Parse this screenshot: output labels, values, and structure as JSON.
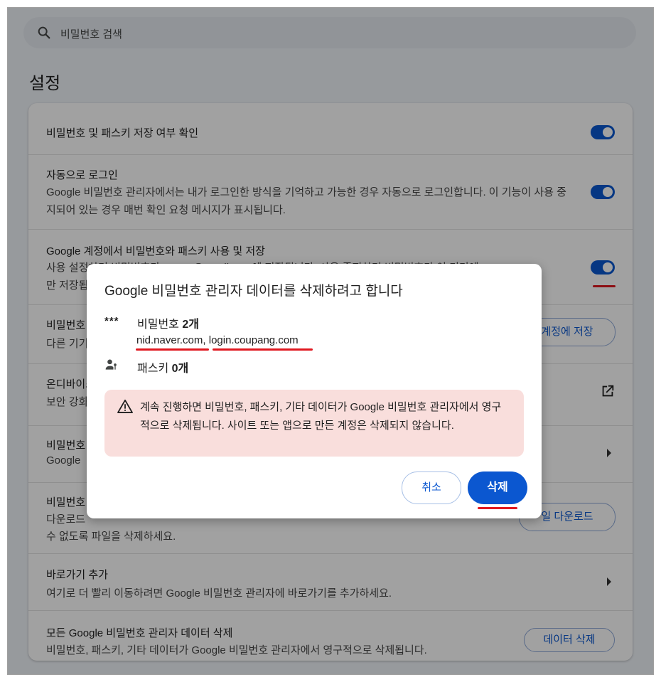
{
  "search": {
    "placeholder": "비밀번호 검색",
    "icon": "search-icon"
  },
  "section_title": "설정",
  "settings": {
    "offer_save": {
      "title": "비밀번호 및 패스키 저장 여부 확인",
      "enabled": true
    },
    "auto_signin": {
      "title": "자동으로 로그인",
      "desc": "Google 비밀번호 관리자에서는 내가 로그인한 방식을 기억하고 가능한 경우 자동으로 로그인합니다. 이 기능이 사용 중지되어 있는 경우 매번 확인 요청 메시지가 표시됩니다.",
      "enabled": true
    },
    "account_storage": {
      "title": "Google 계정에서 비밀번호와 패스키 사용 및 저장",
      "desc_line1": "사용 설정하면 비밀번호가 ..........@gmail.com에 저장됩니다. 사용 중지하면 비밀번호가 이 기기에",
      "desc_line2": "만 저장됩니다.",
      "enabled": true
    },
    "move_passwords": {
      "title": "비밀번호",
      "desc": "다른 기기",
      "button": "계정에 저장"
    },
    "on_device": {
      "title": "온디바이스",
      "desc": "보안 강화",
      "icon": "open-in-new-icon"
    },
    "manage": {
      "title": "비밀번호",
      "desc": "Google"
    },
    "export": {
      "title": "비밀번호",
      "desc_line1": "다운로드",
      "desc_line2": "수 없도록 파일을 삭제하세요.",
      "button": "일 다운로드"
    },
    "shortcut": {
      "title": "바로가기 추가",
      "desc": "여기로 더 빨리 이동하려면 Google 비밀번호 관리자에 바로가기를 추가하세요."
    },
    "delete_all": {
      "title": "모든 Google 비밀번호 관리자 데이터 삭제",
      "desc": "비밀번호, 패스키, 기타 데이터가 Google 비밀번호 관리자에서 영구적으로 삭제됩니다.",
      "button": "데이터 삭제"
    }
  },
  "dialog": {
    "title": "Google 비밀번호 관리자 데이터를 삭제하려고 합니다",
    "password_icon": "***",
    "passwords_label": "비밀번호 ",
    "passwords_count": "2개",
    "sites": [
      "nid.naver.com",
      "login.coupang.com"
    ],
    "site_separator": ", ",
    "passkeys_label": "패스키 ",
    "passkeys_count": "0개",
    "warning": "계속 진행하면 비밀번호, 패스키, 기타 데이터가 Google 비밀번호 관리자에서 영구적으로 삭제됩니다. 사이트 또는 앱으로 만든 계정은 삭제되지 않습니다.",
    "cancel": "취소",
    "delete": "삭제"
  },
  "colors": {
    "accent": "#0b57d0",
    "annotation": "#e0171f",
    "warning_bg": "#f9dedc"
  }
}
